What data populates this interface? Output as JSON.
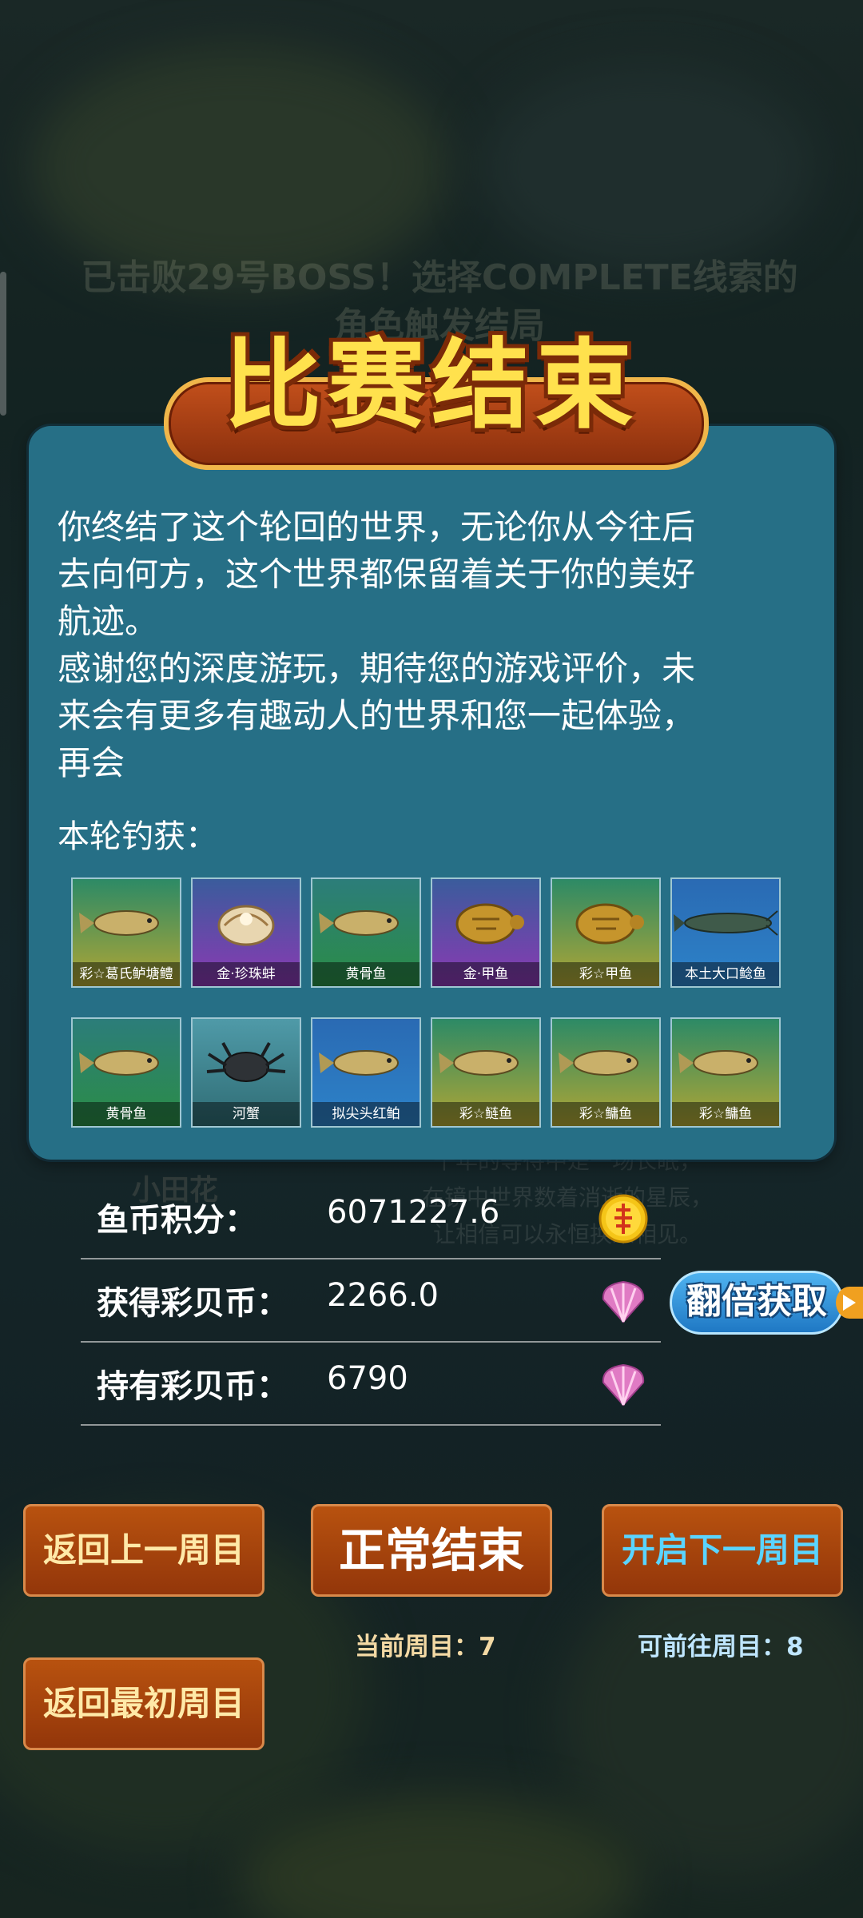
{
  "background": {
    "boss_text": "已击败29号BOSS！选择COMPLETE线索的角色触发结局",
    "faded_poem": [
      "千年的等待中是一场长眠，",
      "在镜中世界数着消逝的星辰，",
      "让相信可以永恒换来相见。"
    ],
    "faded_name": "小田花"
  },
  "dialog": {
    "title": "比赛结束",
    "message_lines": [
      "你终结了这个轮回的世界，无论你从今往后",
      "去向何方，这个世界都保留着关于你的美好",
      "航迹。",
      "感谢您的深度游玩，期待您的游戏评价，未",
      "来会有更多有趣动人的世界和您一起体验，",
      "再会"
    ],
    "catch_label": "本轮钓获：",
    "fish": [
      {
        "name": "彩☆葛氏鲈塘鳢",
        "rarity": "gold",
        "icon": "fish-icon"
      },
      {
        "name": "金·珍珠蚌",
        "rarity": "purple",
        "icon": "clam-icon"
      },
      {
        "name": "黄骨鱼",
        "rarity": "green",
        "icon": "fish-icon"
      },
      {
        "name": "金·甲鱼",
        "rarity": "purple",
        "icon": "turtle-icon"
      },
      {
        "name": "彩☆甲鱼",
        "rarity": "gold",
        "icon": "turtle-icon"
      },
      {
        "name": "本土大口鲶鱼",
        "rarity": "blue",
        "icon": "catfish-icon"
      },
      {
        "name": "黄骨鱼",
        "rarity": "green",
        "icon": "fish-icon"
      },
      {
        "name": "河蟹",
        "rarity": "gray",
        "icon": "crab-icon"
      },
      {
        "name": "拟尖头红鲌",
        "rarity": "blue",
        "icon": "fish-icon"
      },
      {
        "name": "彩☆鲢鱼",
        "rarity": "gold",
        "icon": "fish-icon"
      },
      {
        "name": "彩☆鳙鱼",
        "rarity": "gold",
        "icon": "fish-icon"
      },
      {
        "name": "彩☆鳙鱼",
        "rarity": "gold",
        "icon": "fish-icon"
      }
    ]
  },
  "stats": {
    "fish_coin_label": "鱼币积分：",
    "fish_coin_value": "6071227.6",
    "earned_shell_label": "获得彩贝币：",
    "earned_shell_value": "2266.0",
    "held_shell_label": "持有彩贝币：",
    "held_shell_value": "6790",
    "double_button": "翻倍获取"
  },
  "actions": {
    "prev_cycle": "返回上一周目",
    "normal_end": "正常结束",
    "next_cycle": "开启下一周目",
    "first_cycle": "返回最初周目",
    "current_cycle_label": "当前周目：7",
    "available_cycle_label": "可前往周目：8"
  },
  "colors": {
    "panel": "#266f86",
    "title": "#ffe14d",
    "button": "#a8440c",
    "next_text": "#5ad4ff",
    "current_cycle_text": "#f3d9a4",
    "available_cycle_text": "#bfe6ff"
  }
}
